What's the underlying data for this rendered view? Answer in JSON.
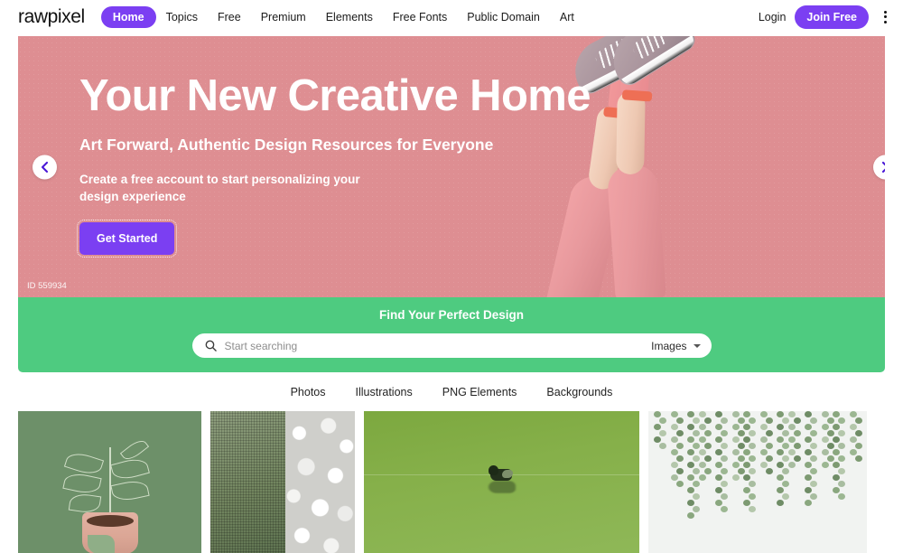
{
  "nav": {
    "logo": "rawpixel",
    "links": [
      {
        "label": "Home",
        "active": true
      },
      {
        "label": "Topics",
        "active": false
      },
      {
        "label": "Free",
        "active": false
      },
      {
        "label": "Premium",
        "active": false
      },
      {
        "label": "Elements",
        "active": false
      },
      {
        "label": "Free Fonts",
        "active": false
      },
      {
        "label": "Public Domain",
        "active": false
      },
      {
        "label": "Art",
        "active": false
      }
    ],
    "login_label": "Login",
    "join_label": "Join Free",
    "menu_icon": "kebab-menu-icon",
    "accent_color": "#7b3ff2"
  },
  "hero": {
    "title": "Your New Creative Home",
    "subtitle": "Art Forward, Authentic Design Resources for Everyone",
    "description": "Create a free account to start personalizing your design experience",
    "cta_label": "Get Started",
    "image_id": "ID 559934",
    "prev_icon": "chevron-left-icon",
    "next_icon": "chevron-right-icon",
    "background_color": "#de8e92"
  },
  "search": {
    "band_title": "Find Your Perfect Design",
    "placeholder": "Start searching",
    "value": "",
    "type_label": "Images",
    "search_icon": "search-icon",
    "caret_icon": "chevron-down-icon",
    "band_color": "#4ecb80"
  },
  "categories": [
    {
      "label": "Photos"
    },
    {
      "label": "Illustrations"
    },
    {
      "label": "PNG Elements"
    },
    {
      "label": "Backgrounds"
    }
  ],
  "gallery": [
    {
      "name": "potted-plant-illustration"
    },
    {
      "name": "green-fabric-white-pebbles"
    },
    {
      "name": "duck-on-green-water"
    },
    {
      "name": "hanging-vine-plants"
    }
  ]
}
